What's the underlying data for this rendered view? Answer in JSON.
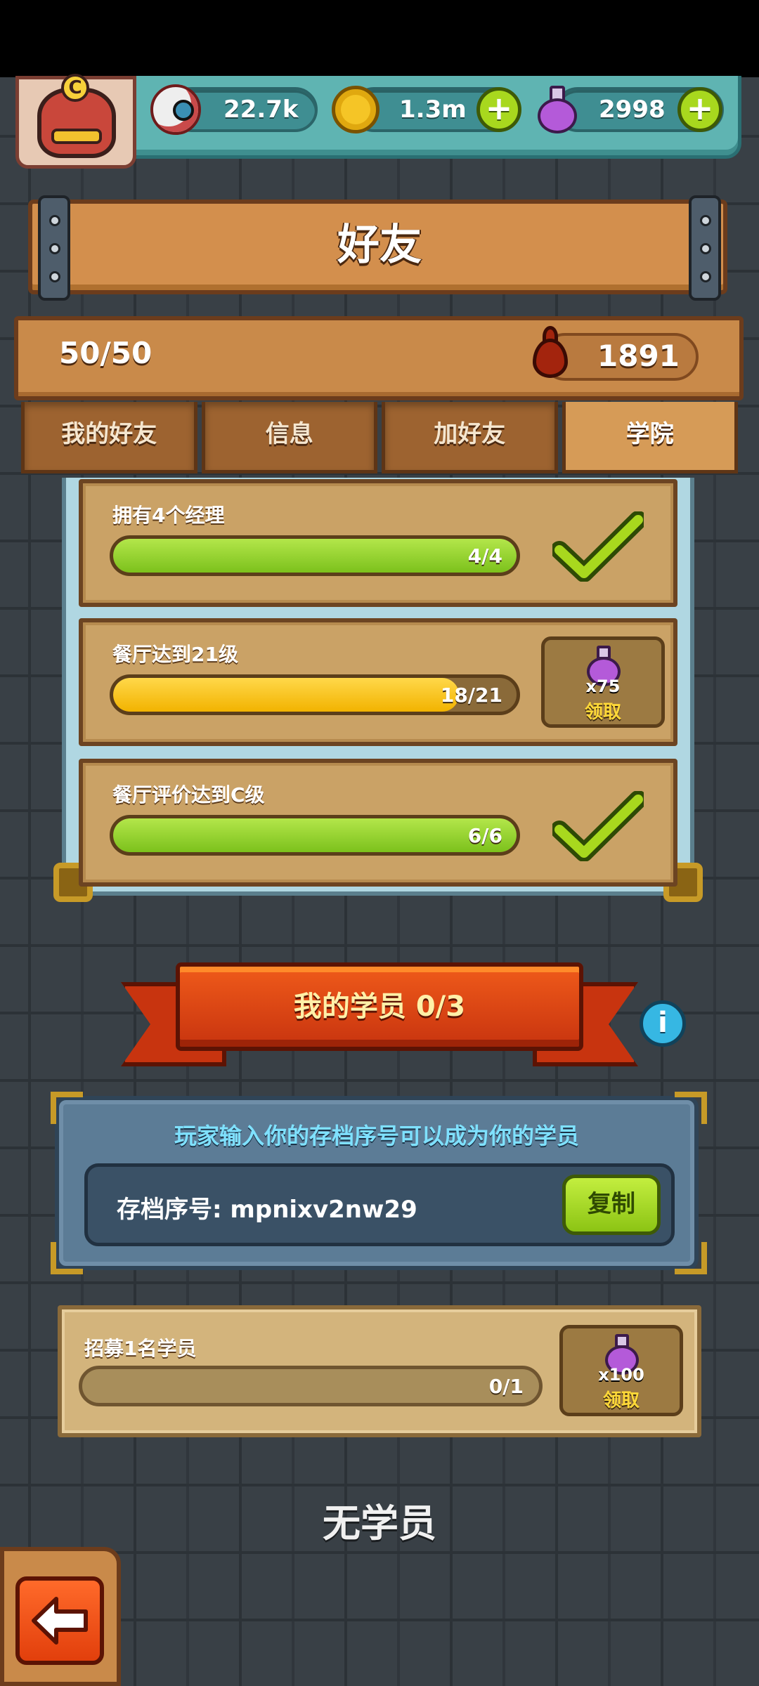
{
  "resources": {
    "eyes": "22.7k",
    "coins": "1.3m",
    "potions": "2998",
    "rank_badge": "C"
  },
  "title": "好友",
  "friends_count": "50/50",
  "blood": "1891",
  "tabs": [
    {
      "label": "我的好友",
      "active": false
    },
    {
      "label": "信息",
      "active": false
    },
    {
      "label": "加好友",
      "active": false
    },
    {
      "label": "学院",
      "active": true
    }
  ],
  "tasks": [
    {
      "label": "拥有4个经理",
      "progress": "4/4",
      "fraction": 1.0,
      "color": "green",
      "status": "done"
    },
    {
      "label": "餐厅达到21级",
      "progress": "18/21",
      "fraction": 0.857,
      "color": "yellow",
      "status": "claim",
      "reward_amount": "x75",
      "claim_label": "领取"
    },
    {
      "label": "餐厅评价达到C级",
      "progress": "6/6",
      "fraction": 1.0,
      "color": "green",
      "status": "done"
    }
  ],
  "students_banner": "我的学员 0/3",
  "invite": {
    "hint": "玩家输入你的存档序号可以成为你的学员",
    "code_label": "存档序号: mpnixv2nw29",
    "copy_label": "复制"
  },
  "recruit": {
    "label": "招募1名学员",
    "progress": "0/1",
    "reward_amount": "x100",
    "claim_label": "领取"
  },
  "empty_text": "无学员",
  "colors": {
    "accent_green": "#a8d81e",
    "accent_yellow": "#f2b300",
    "banner_red": "#c8340f",
    "hint_cyan": "#7fe1ff"
  }
}
